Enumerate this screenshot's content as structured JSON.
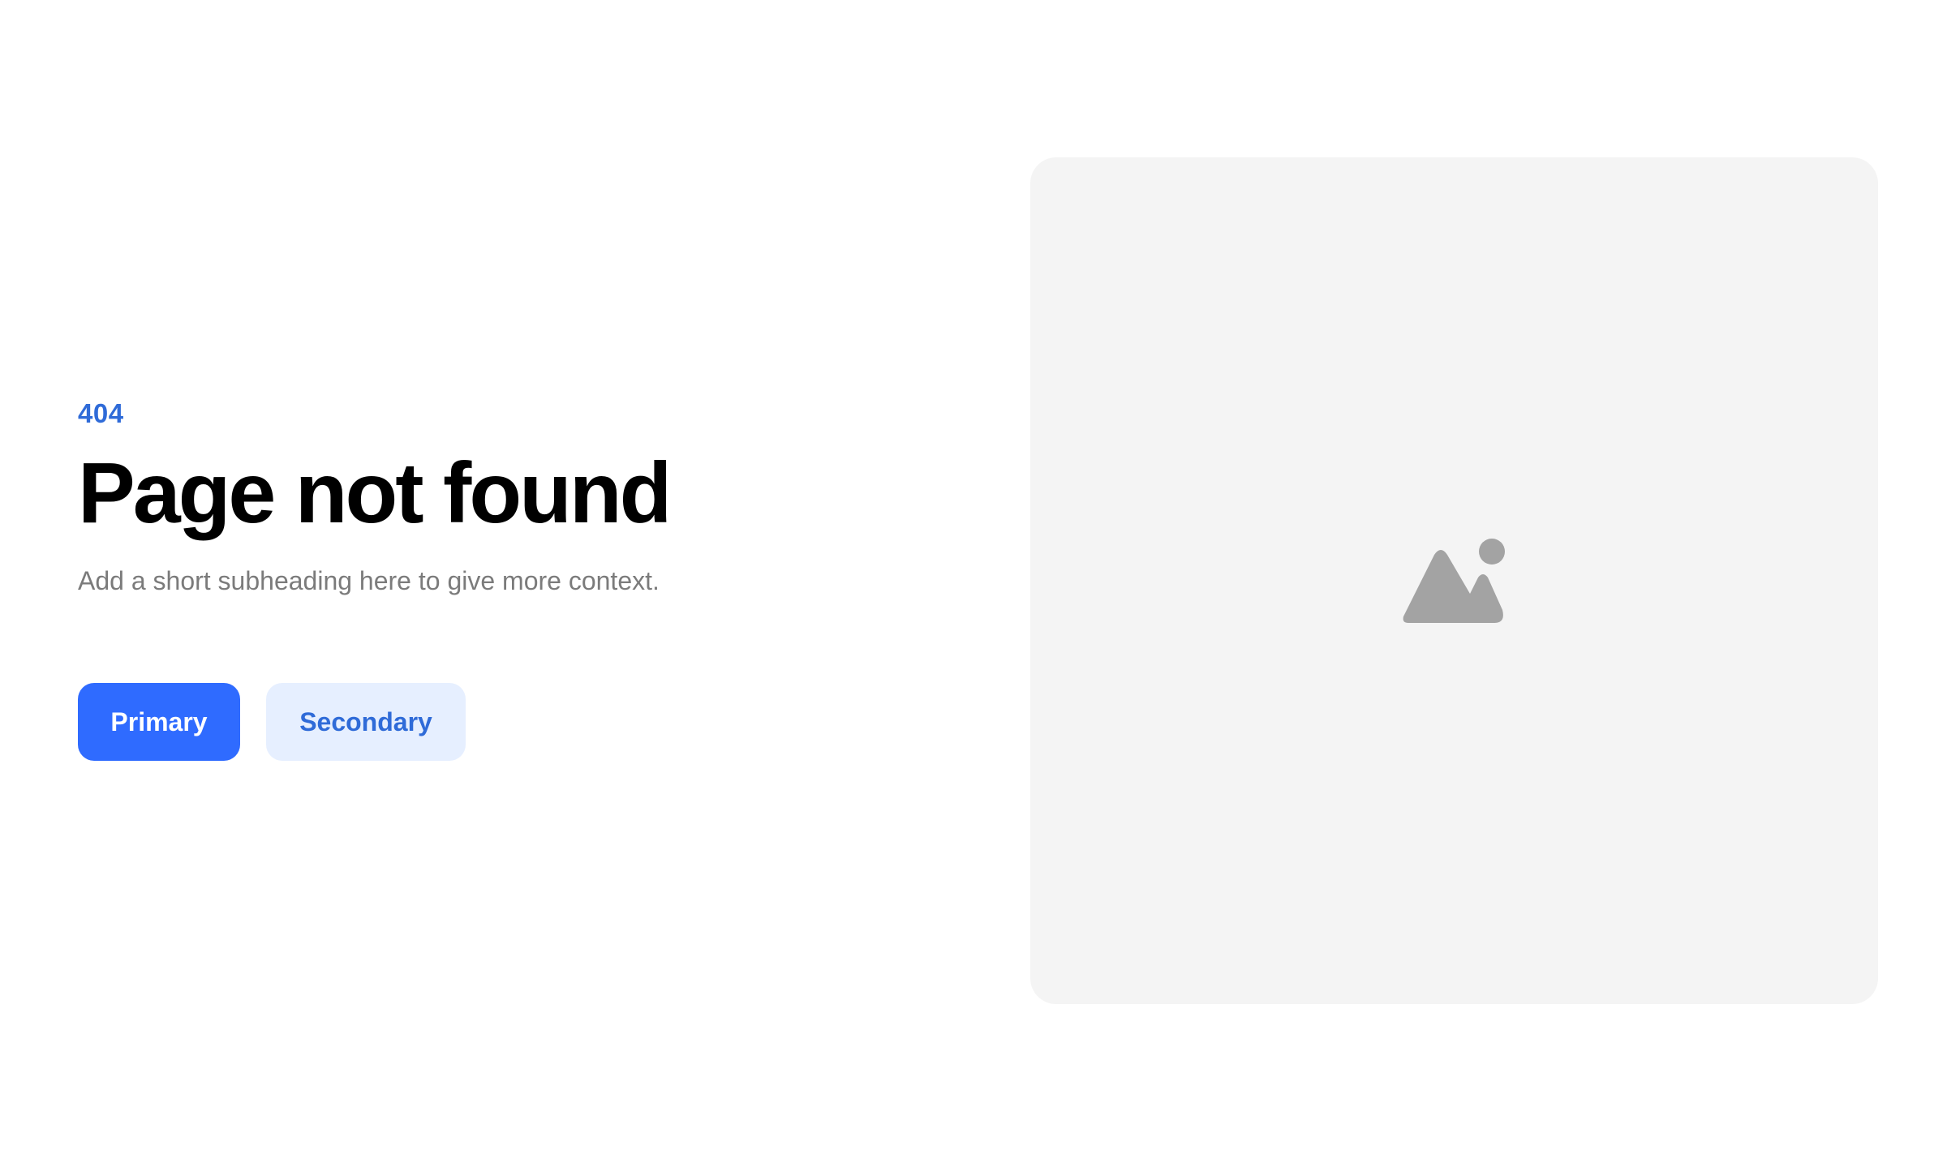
{
  "error": {
    "code": "404",
    "title": "Page not found",
    "subheading": "Add a short subheading here to give more context."
  },
  "actions": {
    "primary_label": "Primary",
    "secondary_label": "Secondary"
  },
  "media": {
    "icon": "image-placeholder-icon"
  },
  "colors": {
    "accent": "#2f6bff",
    "accent_text": "#2f6bd8",
    "secondary_bg": "#e6efff",
    "panel_bg": "#f4f4f4",
    "icon": "#a3a3a3",
    "subheading": "#7b7b7b"
  }
}
